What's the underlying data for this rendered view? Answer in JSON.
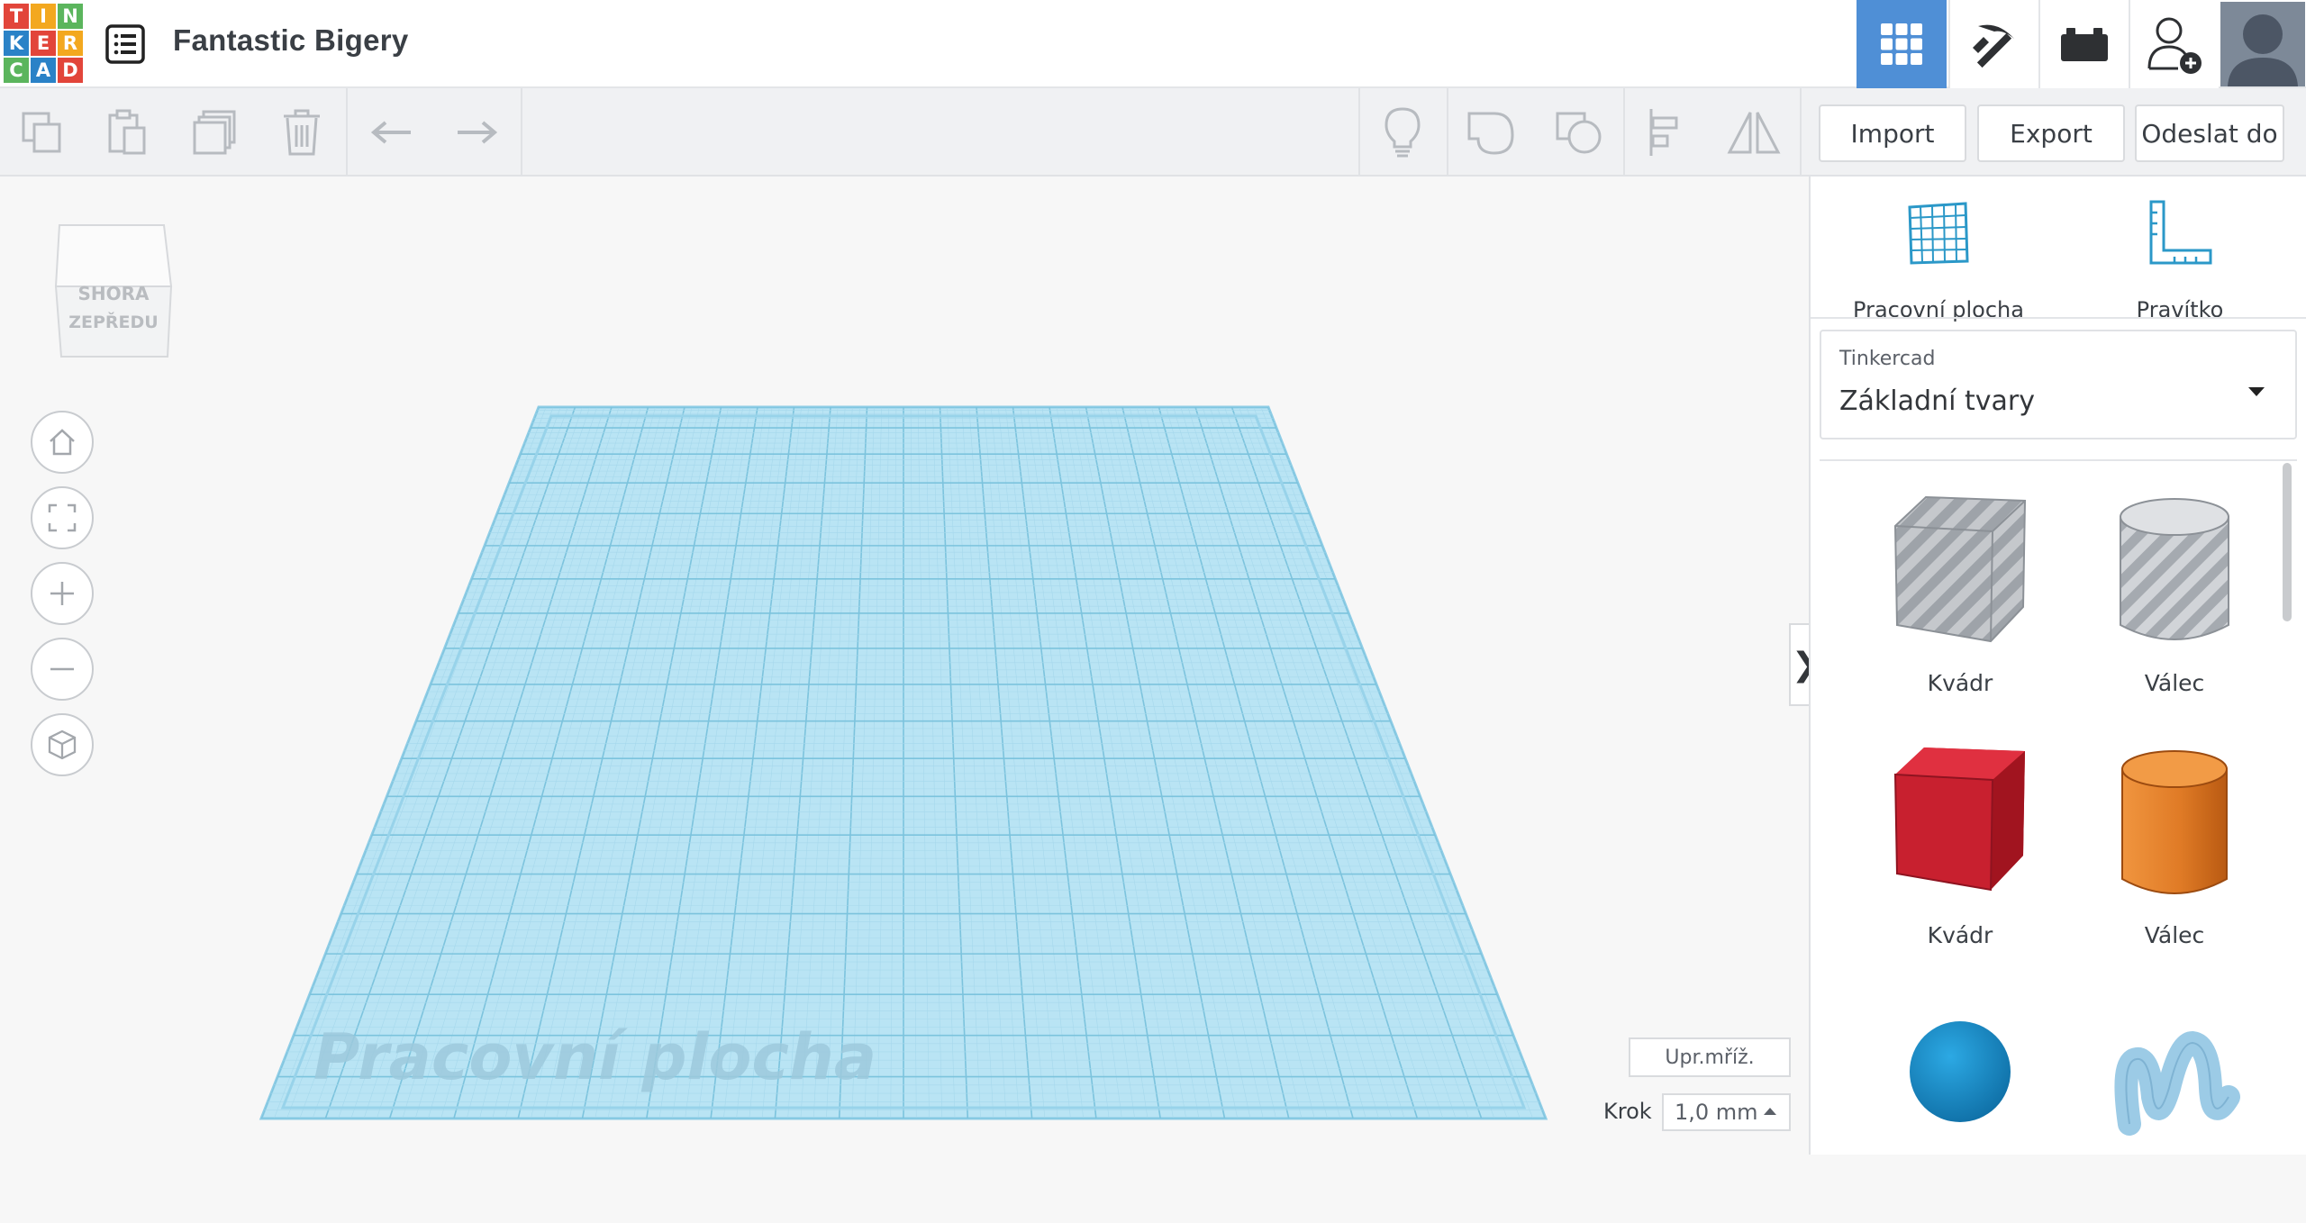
{
  "logo": {
    "letters": [
      "T",
      "I",
      "N",
      "K",
      "E",
      "R",
      "C",
      "A",
      "D"
    ]
  },
  "header": {
    "title": "Fantastic Bigery",
    "buttons": [
      {
        "name": "3d-design-view",
        "icon": "grid-icon",
        "active": true
      },
      {
        "name": "codeblocks",
        "icon": "pickaxe-icon"
      },
      {
        "name": "bricks",
        "icon": "brick-icon"
      },
      {
        "name": "invite",
        "icon": "add-user-icon"
      }
    ]
  },
  "toolbar": {
    "import_label": "Import",
    "export_label": "Export",
    "send_label": "Odeslat do"
  },
  "viewcube": {
    "top": "SHORA",
    "front": "ZEPŘEDU"
  },
  "workplane": {
    "watermark": "Pracovní plocha"
  },
  "grid": {
    "edit_label": "Upr.mříž.",
    "step_label": "Krok",
    "step_value": "1,0 mm"
  },
  "panel": {
    "workplane_label": "Pracovní plocha",
    "ruler_label": "Pravítko",
    "library_source": "Tinkercad",
    "library_value": "Základní tvary",
    "shapes": [
      {
        "label": "Kvádr",
        "icon": "box-hole-icon"
      },
      {
        "label": "Válec",
        "icon": "cylinder-hole-icon"
      },
      {
        "label": "Kvádr",
        "icon": "box-icon"
      },
      {
        "label": "Válec",
        "icon": "cylinder-icon"
      },
      {
        "label": "",
        "icon": "sphere-icon"
      },
      {
        "label": "",
        "icon": "scribble-icon"
      }
    ]
  },
  "colors": {
    "accent": "#4f8fd6",
    "workplane": "#a9dcf0",
    "box_red": "#c8202f",
    "cylinder_orange": "#e07b26",
    "sphere_blue": "#1b96d4",
    "scribble_blue": "#9ccbe6"
  }
}
